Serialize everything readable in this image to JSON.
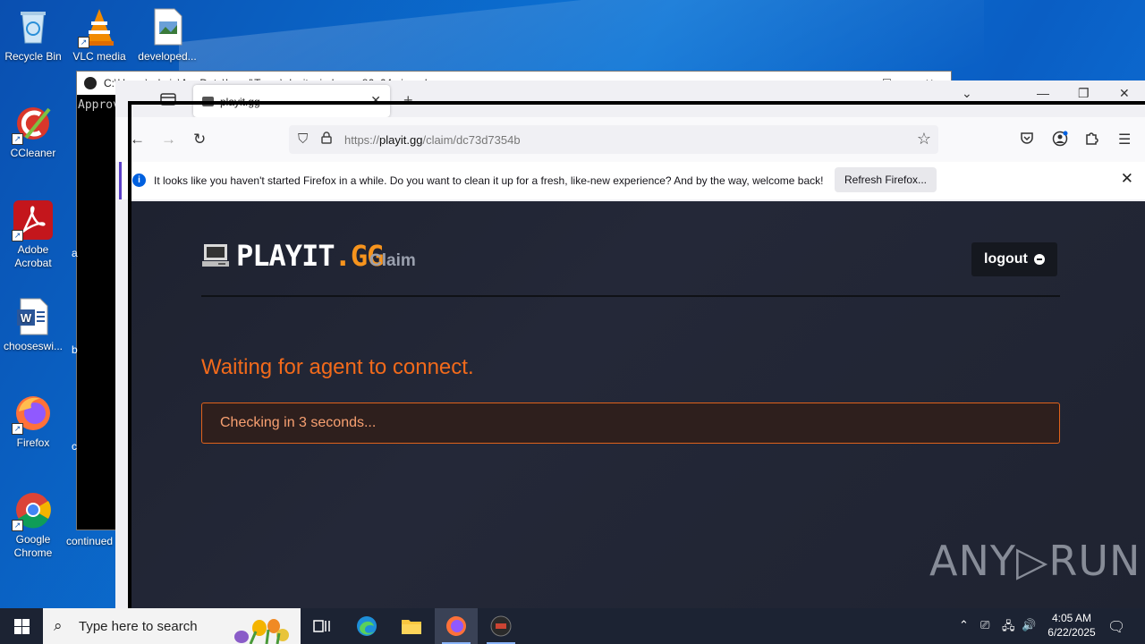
{
  "desktop": {
    "icons": [
      {
        "label": "Recycle Bin"
      },
      {
        "label": "VLC media"
      },
      {
        "label": "developed..."
      },
      {
        "label": "CCleaner"
      },
      {
        "label": "Adobe Acrobat"
      },
      {
        "label": "chooseswi..."
      },
      {
        "label": "Firefox"
      },
      {
        "label": "Google Chrome"
      },
      {
        "label": "continued"
      }
    ]
  },
  "console": {
    "title": "C:\\Users\\admin\\AppData\\Local\\Temp\\playit-windows-x86_64-signed.exe",
    "text": "Approv",
    "side_labels": [
      "a",
      "b",
      "c"
    ]
  },
  "browser": {
    "tab_title": "playit.gg",
    "url_prefix": "https://",
    "url_domain": "playit.gg",
    "url_path": "/claim/dc73d7354b",
    "notification": {
      "message": "It looks like you haven't started Firefox in a while. Do you want to clean it up for a fresh, like-new experience? And by the way, welcome back!",
      "button": "Refresh Firefox..."
    }
  },
  "page": {
    "logo_main": "PLAYIT",
    "logo_accent": ".GG",
    "section": "Claim",
    "logout": "logout",
    "status_heading": "Waiting for agent to connect.",
    "status_message": "Checking in 3 seconds...",
    "accent_color": "#f26a1b"
  },
  "watermark": "ANY▷RUN",
  "taskbar": {
    "search_placeholder": "Type here to search",
    "time": "4:05 AM",
    "date": "6/22/2025"
  }
}
